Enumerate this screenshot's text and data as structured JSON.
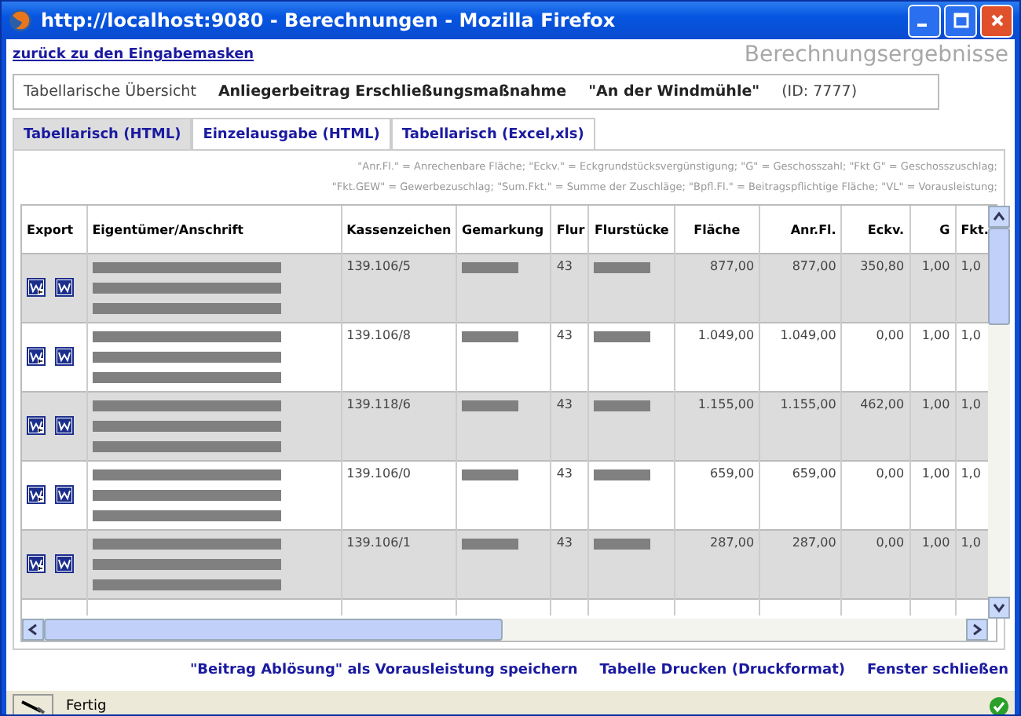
{
  "window": {
    "title": "http://localhost:9080 - Berechnungen - Mozilla Firefox"
  },
  "back_link": "zurück zu den Eingabemasken",
  "page_title": "Berechnungsergebnisse",
  "info": {
    "label": "Tabellarische Übersicht",
    "measure": "Anliegerbeitrag Erschließungsmaßnahme",
    "name": "\"An der Windmühle\"",
    "id": "(ID: 7777)"
  },
  "tabs": [
    {
      "label": "Tabellarisch (HTML)",
      "selected": true
    },
    {
      "label": "Einzelausgabe (HTML)",
      "selected": false
    },
    {
      "label": "Tabellarisch (Excel,xls)",
      "selected": false
    }
  ],
  "legend": [
    "\"Anr.Fl.\" = Anrechenbare Fläche; \"Eckv.\" = Eckgrundstücksvergünstigung; \"G\" = Geschosszahl; \"Fkt G\" = Geschosszuschlag;",
    "\"Fkt.GEW\" = Gewerbezuschlag; \"Sum.Fkt.\" = Summe der Zuschläge; \"Bpfl.Fl.\" = Beitragspflichtige Fläche; \"VL\" = Vorausleistung;"
  ],
  "table": {
    "columns": [
      "Export",
      "Eigentümer/Anschrift",
      "Kassenzeichen",
      "Gemarkung",
      "Flur",
      "Flurstücke",
      "Fläche",
      "Anr.Fl.",
      "Eckv.",
      "G",
      "Fkt."
    ],
    "rows": [
      {
        "kassenzeichen": "139.106/5",
        "flur": "43",
        "flaeche": "877,00",
        "anr_fl": "877,00",
        "eckv": "350,80",
        "g": "1,00",
        "fkt": "1,0"
      },
      {
        "kassenzeichen": "139.106/8",
        "flur": "43",
        "flaeche": "1.049,00",
        "anr_fl": "1.049,00",
        "eckv": "0,00",
        "g": "1,00",
        "fkt": "1,0"
      },
      {
        "kassenzeichen": "139.118/6",
        "flur": "43",
        "flaeche": "1.155,00",
        "anr_fl": "1.155,00",
        "eckv": "462,00",
        "g": "1,00",
        "fkt": "1,0"
      },
      {
        "kassenzeichen": "139.106/0",
        "flur": "43",
        "flaeche": "659,00",
        "anr_fl": "659,00",
        "eckv": "0,00",
        "g": "1,00",
        "fkt": "1,0"
      },
      {
        "kassenzeichen": "139.106/1",
        "flur": "43",
        "flaeche": "287,00",
        "anr_fl": "287,00",
        "eckv": "0,00",
        "g": "1,00",
        "fkt": "1,0"
      }
    ]
  },
  "actions": [
    "\"Beitrag Ablösung\" als Vorausleistung speichern",
    "Tabelle Drucken (Druckformat)",
    "Fenster schließen"
  ],
  "status_bar": {
    "text": "Fertig"
  }
}
